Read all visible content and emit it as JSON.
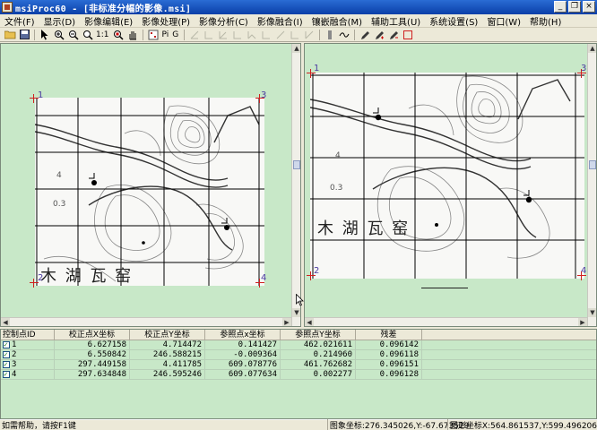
{
  "window": {
    "title": "msiProc60 - [非标准分幅的影像.msi]",
    "minimize_glyph": "_",
    "restore_glyph": "❐",
    "close_glyph": "×"
  },
  "menu": [
    {
      "label": "文件(F)"
    },
    {
      "label": "显示(D)"
    },
    {
      "label": "影像编辑(E)"
    },
    {
      "label": "影像处理(P)"
    },
    {
      "label": "影像分析(C)"
    },
    {
      "label": "影像融合(I)"
    },
    {
      "label": "镶嵌融合(M)"
    },
    {
      "label": "辅助工具(U)"
    },
    {
      "label": "系统设置(S)"
    },
    {
      "label": "窗口(W)"
    },
    {
      "label": "帮助(H)"
    }
  ],
  "toolbar": {
    "zoom_1to1": "1:1",
    "pi_label": "Pi",
    "g_label": "G"
  },
  "left_view": {
    "gcp_labels": [
      "1",
      "3",
      "2",
      "4"
    ],
    "map_text": "木 湖 瓦 窑",
    "map_num_1": "4",
    "map_num_2": "0.3"
  },
  "right_view": {
    "gcp_labels": [
      "1",
      "3",
      "2",
      "4"
    ],
    "map_text": "木 湖 瓦 窑",
    "map_num_1": "4",
    "map_num_2": "0.3"
  },
  "table": {
    "headers": [
      "控制点ID",
      "校正点X坐标",
      "校正点Y坐标",
      "参照点x坐标",
      "参照点Y坐标",
      "残差"
    ],
    "rows": [
      {
        "id": "1",
        "x": "6.627158",
        "y": "4.714472",
        "rx": "0.141427",
        "ry": "462.021611",
        "res": "0.096142"
      },
      {
        "id": "2",
        "x": "6.550842",
        "y": "246.588215",
        "rx": "-0.009364",
        "ry": "0.214960",
        "res": "0.096118"
      },
      {
        "id": "3",
        "x": "297.449158",
        "y": "4.411785",
        "rx": "609.078776",
        "ry": "461.762682",
        "res": "0.096151"
      },
      {
        "id": "4",
        "x": "297.634848",
        "y": "246.595246",
        "rx": "609.077634",
        "ry": "0.002277",
        "res": "0.096128"
      }
    ]
  },
  "status": {
    "help": "如需帮助，请按F1键",
    "image_coord": "图象坐标:276.345026,Y:-67.673529",
    "map_coord": "图形坐标X:564.861537,Y:599.496206"
  }
}
